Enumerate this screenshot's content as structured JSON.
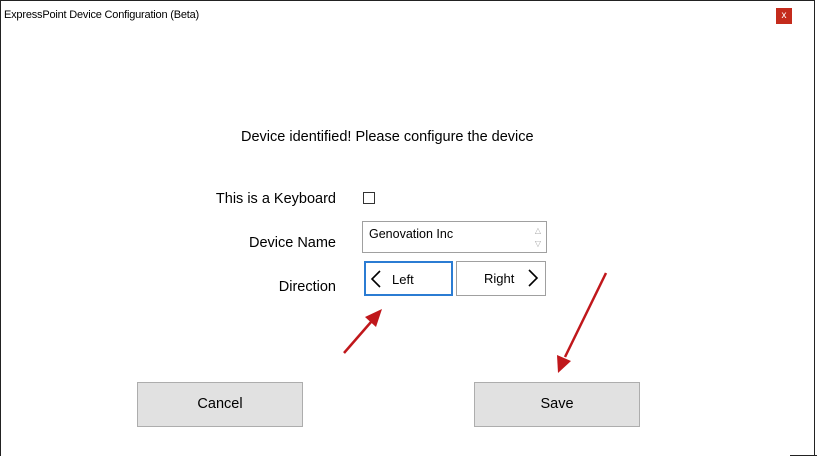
{
  "window": {
    "title": "ExpressPoint Device Configuration (Beta)",
    "close_label": "x"
  },
  "main": {
    "heading": "Device identified! Please configure the device",
    "keyboard_label": "This is a Keyboard",
    "keyboard_checked": false,
    "device_name_label": "Device Name",
    "device_name_value": "Genovation Inc",
    "direction_label": "Direction",
    "direction_left": "Left",
    "direction_right": "Right"
  },
  "actions": {
    "cancel_label": "Cancel",
    "save_label": "Save"
  },
  "colors": {
    "close_button": "#c42b1c",
    "selection_border": "#2b7cd3",
    "annotation_arrow": "#c0171b",
    "button_face": "#e1e1e1"
  }
}
